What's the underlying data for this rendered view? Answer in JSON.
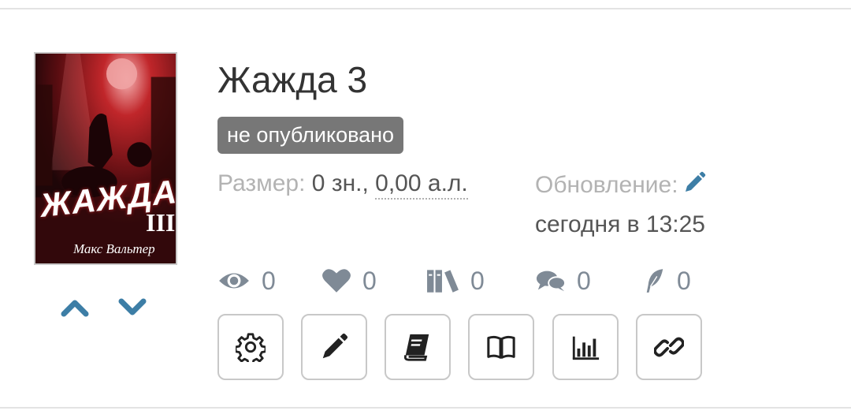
{
  "book": {
    "title": "Жажда 3",
    "status_badge": "не опубликовано",
    "cover": {
      "title_text": "ЖАЖДА",
      "volume_text": "III",
      "author_text": "Макс Вальтер"
    }
  },
  "meta": {
    "size_label": "Размер:",
    "size_chars": "0 зн.,",
    "size_sheets": "0,00 а.л.",
    "updated_label": "Обновление:",
    "updated_value": "сегодня в 13:25"
  },
  "stats": {
    "views": "0",
    "likes": "0",
    "libraries": "0",
    "comments": "0",
    "reviews": "0"
  },
  "colors": {
    "accent": "#3d7ea6",
    "stat_icon": "#7f8a96",
    "badge_bg": "#777777"
  },
  "icons": {
    "move_up": "chevron-up-icon",
    "move_down": "chevron-down-icon",
    "edit_date": "pencil-icon",
    "views": "eye-icon",
    "likes": "heart-icon",
    "libraries": "books-icon",
    "comments": "comments-icon",
    "reviews": "feather-icon",
    "actions": [
      "gear-icon",
      "pencil-icon",
      "book-icon",
      "open-book-icon",
      "bar-chart-icon",
      "link-icon"
    ]
  }
}
